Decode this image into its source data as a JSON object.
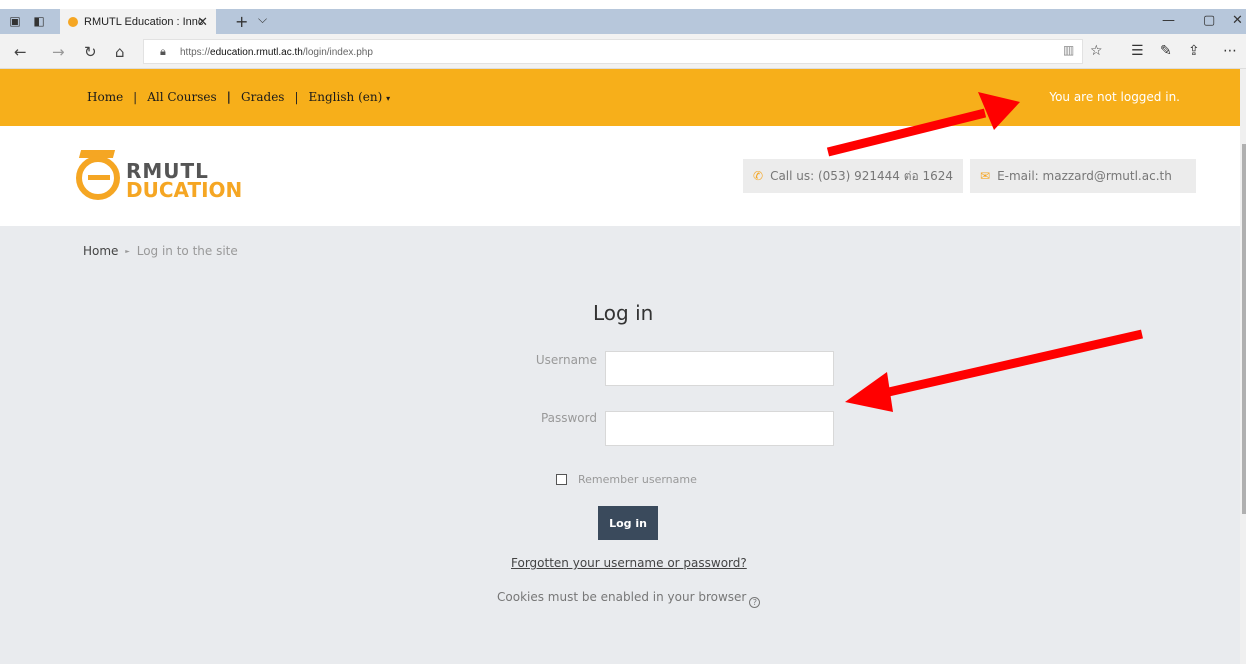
{
  "browser": {
    "tab_title": "RMUTL Education : Innc",
    "tab_close": "✕",
    "new_tab": "+",
    "tab_menu": "⌵",
    "url_prefix": "https://",
    "url_domain": "education.rmutl.ac.th",
    "url_path": "/login/index.php",
    "window_controls": {
      "minimize": "—",
      "maximize": "▢",
      "close": "✕"
    }
  },
  "navbar": {
    "links": [
      "Home",
      "All Courses",
      "Grades",
      "English (en)"
    ],
    "separators": [
      "|",
      "|",
      "|"
    ],
    "status": "You are not logged in.",
    "color": "#f7af1a"
  },
  "header": {
    "logo_line1": "RMUTL",
    "logo_line2": "DUCATION",
    "call": "Call us: (053) 921444 ต่อ 1624",
    "email": "E-mail: mazzard@rmutl.ac.th"
  },
  "breadcrumb": {
    "home": "Home",
    "separator": "►",
    "current": "Log in to the site"
  },
  "login": {
    "title": "Log in",
    "username_label": "Username",
    "password_label": "Password",
    "remember_label": "Remember username",
    "button_label": "Log in",
    "forgot_link": "Forgotten your username or password?",
    "cookies_note": "Cookies must be enabled in your browser",
    "help_glyph": "?"
  },
  "colors": {
    "accent": "#f7af1a",
    "button": "#3a4a5c",
    "annotation_arrow": "#ff0000"
  }
}
